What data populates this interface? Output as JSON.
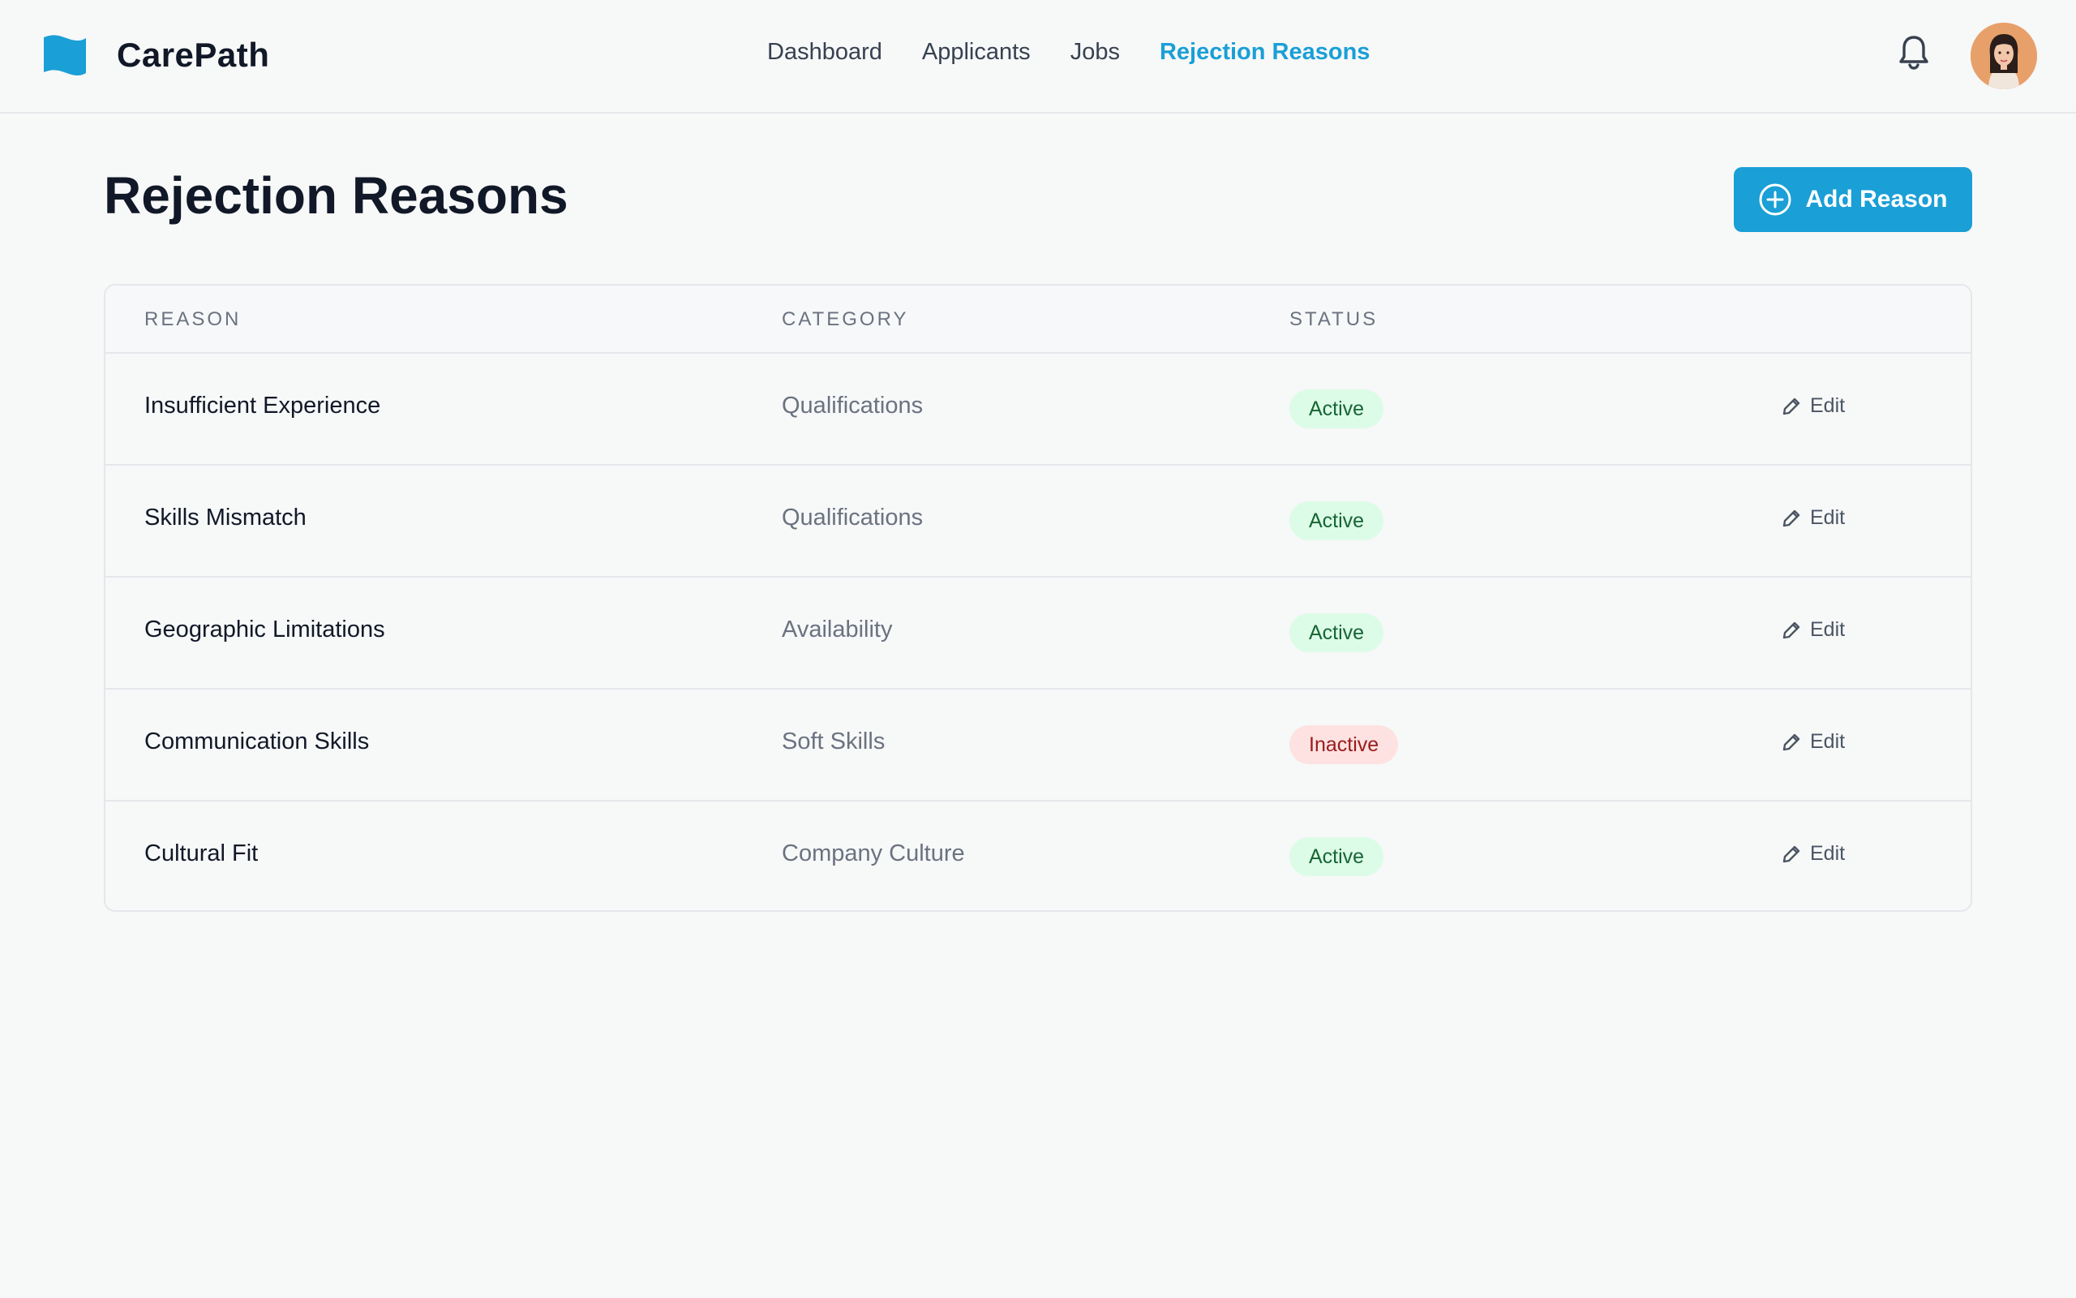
{
  "app": {
    "name": "CarePath"
  },
  "nav": [
    {
      "label": "Dashboard",
      "active": false
    },
    {
      "label": "Applicants",
      "active": false
    },
    {
      "label": "Jobs",
      "active": false
    },
    {
      "label": "Rejection Reasons",
      "active": true
    }
  ],
  "icons": {
    "logo": "flag-logo-icon",
    "notifications": "bell-icon",
    "add": "plus-circle-icon",
    "edit": "pencil-icon"
  },
  "colors": {
    "accent": "#1a9fd6",
    "active_badge_bg": "#dcfce7",
    "active_badge_text": "#166534",
    "inactive_badge_bg": "#fee2e2",
    "inactive_badge_text": "#991b1b"
  },
  "page": {
    "title": "Rejection Reasons",
    "add_button_label": "Add Reason"
  },
  "table": {
    "columns": {
      "reason": "REASON",
      "category": "CATEGORY",
      "status": "STATUS"
    },
    "edit_label": "Edit",
    "rows": [
      {
        "reason": "Insufficient Experience",
        "category": "Qualifications",
        "status": "Active"
      },
      {
        "reason": "Skills Mismatch",
        "category": "Qualifications",
        "status": "Active"
      },
      {
        "reason": "Geographic Limitations",
        "category": "Availability",
        "status": "Active"
      },
      {
        "reason": "Communication Skills",
        "category": "Soft Skills",
        "status": "Inactive"
      },
      {
        "reason": "Cultural Fit",
        "category": "Company Culture",
        "status": "Active"
      }
    ]
  }
}
